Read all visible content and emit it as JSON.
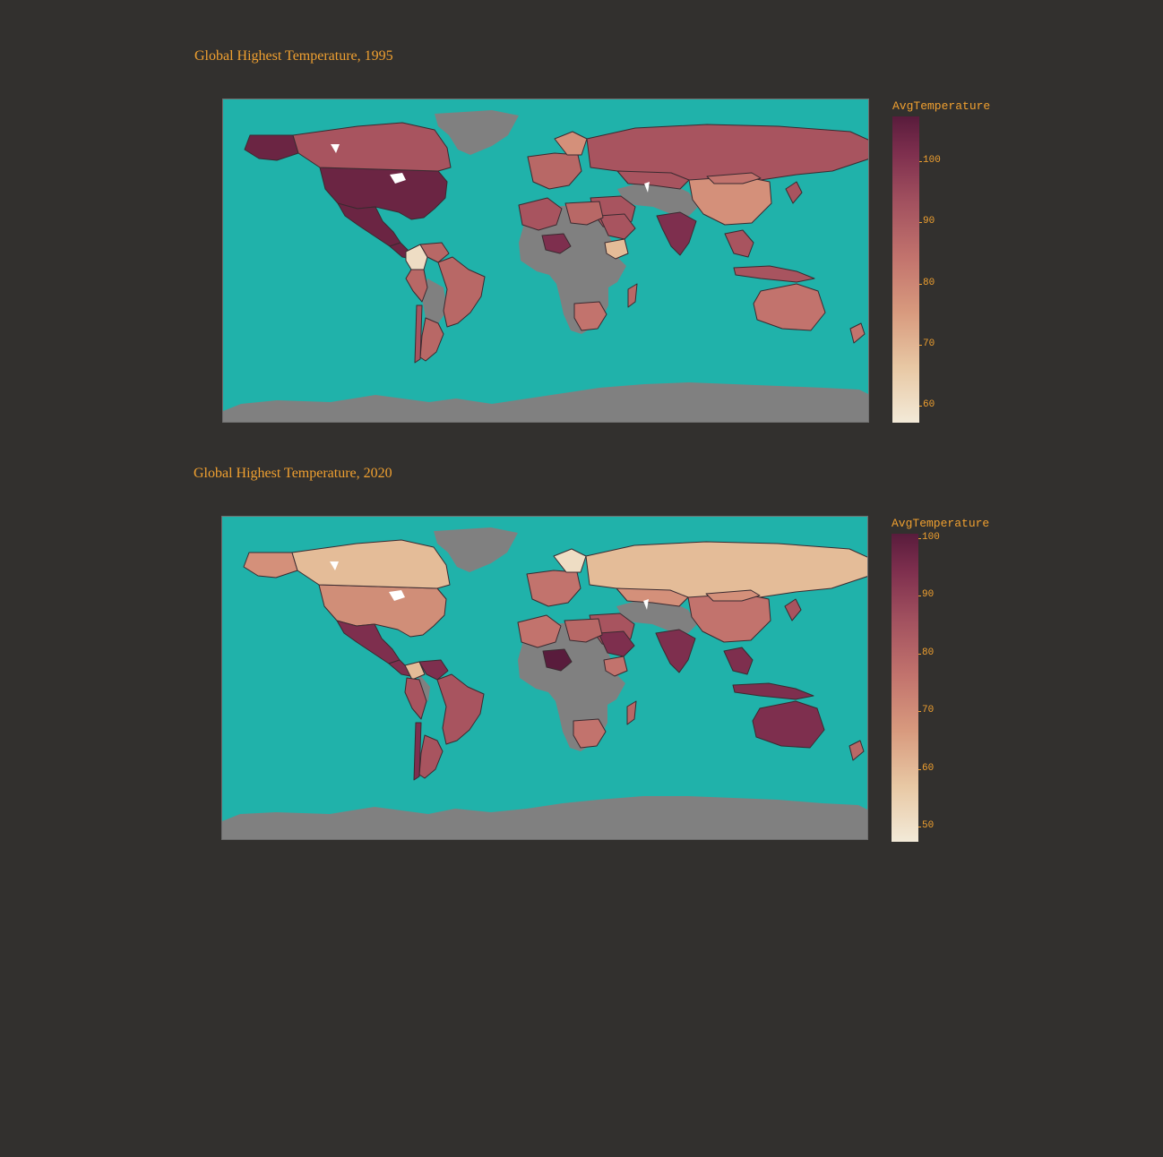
{
  "maps": [
    {
      "title": "Global Highest Temperature, 1995",
      "colorbar_title": "AvgTemperature",
      "ticks": [
        "100",
        "90",
        "80",
        "70",
        "60"
      ]
    },
    {
      "title": "Global Highest Temperature, 2020",
      "colorbar_title": "AvgTemperature",
      "ticks": [
        "100",
        "90",
        "80",
        "70",
        "60",
        "50"
      ]
    }
  ],
  "colors": {
    "ocean": "#20b2aa",
    "no_data_land": "#808080",
    "background": "#32302e",
    "text": "#f0a030"
  }
}
